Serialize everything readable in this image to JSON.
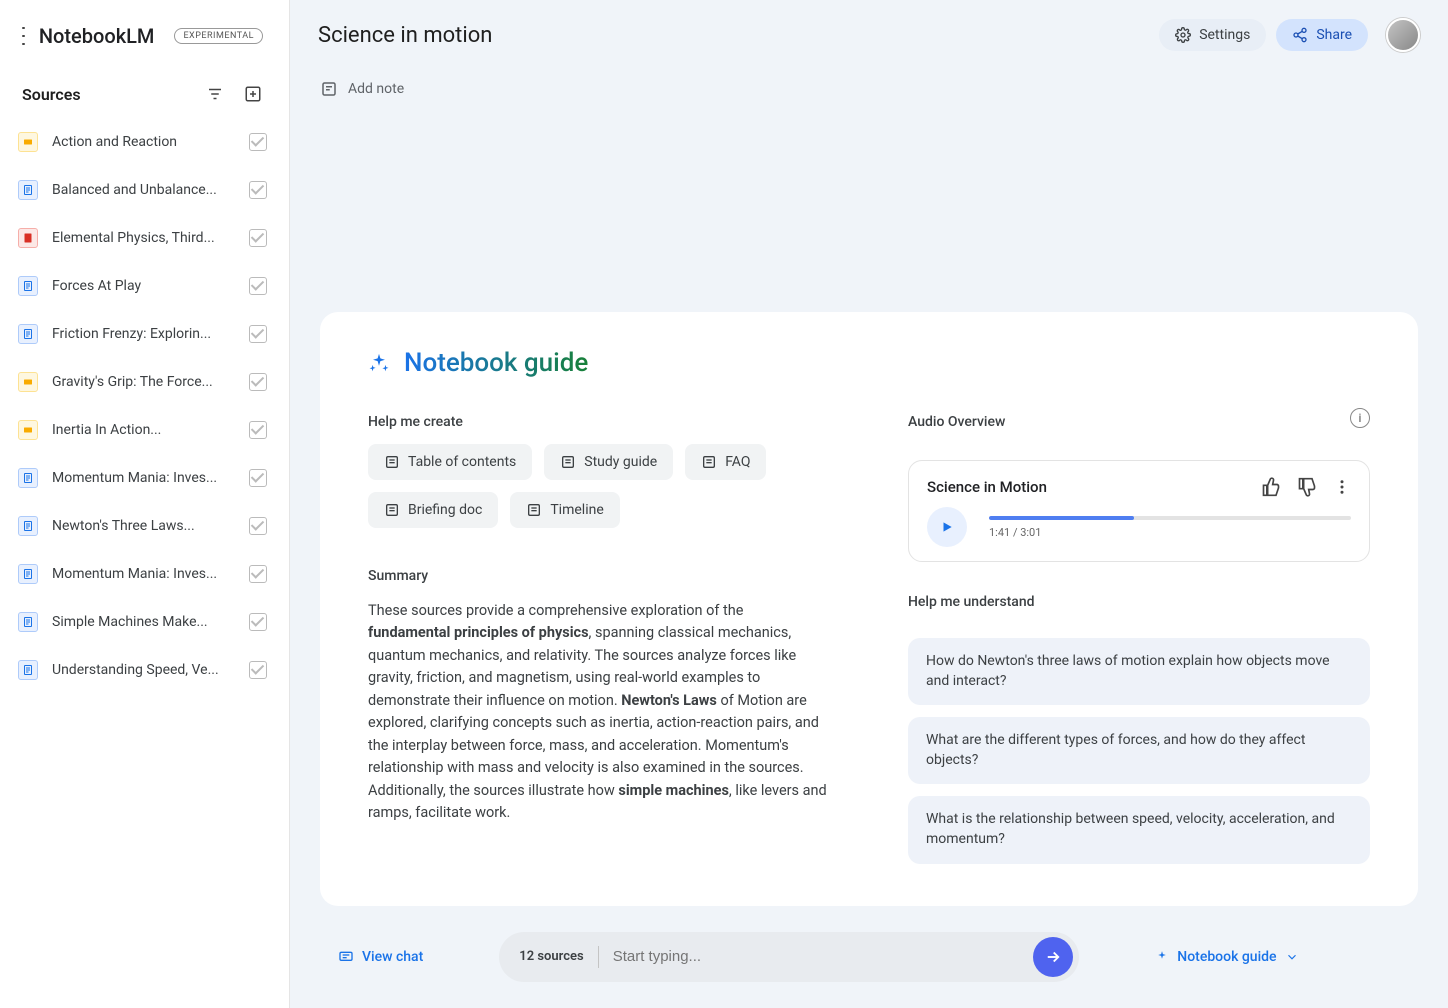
{
  "brand": {
    "name": "NotebookLM",
    "badge": "EXPERIMENTAL"
  },
  "sidebar": {
    "header": "Sources",
    "items": [
      {
        "label": "Action and Reaction",
        "type": "slide"
      },
      {
        "label": "Balanced and Unbalance...",
        "type": "doc"
      },
      {
        "label": "Elemental Physics, Third...",
        "type": "pdf"
      },
      {
        "label": "Forces At Play",
        "type": "doc"
      },
      {
        "label": "Friction Frenzy: Explorin...",
        "type": "doc"
      },
      {
        "label": "Gravity's Grip: The Force...",
        "type": "slide"
      },
      {
        "label": "Inertia In Action...",
        "type": "slide"
      },
      {
        "label": "Momentum Mania: Inves...",
        "type": "doc"
      },
      {
        "label": "Newton's Three Laws...",
        "type": "doc"
      },
      {
        "label": "Momentum Mania: Inves...",
        "type": "doc"
      },
      {
        "label": "Simple Machines Make...",
        "type": "doc"
      },
      {
        "label": "Understanding Speed, Ve...",
        "type": "doc"
      }
    ]
  },
  "topbar": {
    "title": "Science in motion",
    "settings": "Settings",
    "share": "Share"
  },
  "addnote": "Add note",
  "panel": {
    "title": "Notebook guide",
    "help_create_label": "Help me create",
    "chips": [
      "Table of contents",
      "Study guide",
      "FAQ",
      "Briefing doc",
      "Timeline"
    ],
    "summary_label": "Summary",
    "summary_pre": "These sources provide a comprehensive exploration of the ",
    "summary_b1": "fundamental principles of physics",
    "summary_mid": ", spanning classical mechanics, quantum mechanics, and relativity. The sources analyze forces like gravity, friction, and magnetism, using real-world examples to demonstrate their influence on motion. ",
    "summary_b2": "Newton's Laws",
    "summary_mid2": " of Motion are explored, clarifying concepts such as inertia, action-reaction pairs, and the interplay between force, mass, and acceleration. Momentum's relationship with mass and velocity is also examined in the sources. Additionally, the sources illustrate how ",
    "summary_b3": "simple machines",
    "summary_end": ", like levers and ramps, facilitate work.",
    "audio_label": "Audio Overview",
    "audio": {
      "title": "Science in Motion",
      "time": "1:41 / 3:01",
      "progress": 40
    },
    "understand_label": "Help me understand",
    "questions": [
      "How do Newton's three laws of motion explain how objects move and interact?",
      "What are the different types of forces, and how do they affect objects?",
      "What is the relationship between speed, velocity, acceleration, and momentum?"
    ]
  },
  "footer": {
    "view_chat": "View chat",
    "source_count": "12 sources",
    "placeholder": "Start typing...",
    "guide_btn": "Notebook guide"
  }
}
